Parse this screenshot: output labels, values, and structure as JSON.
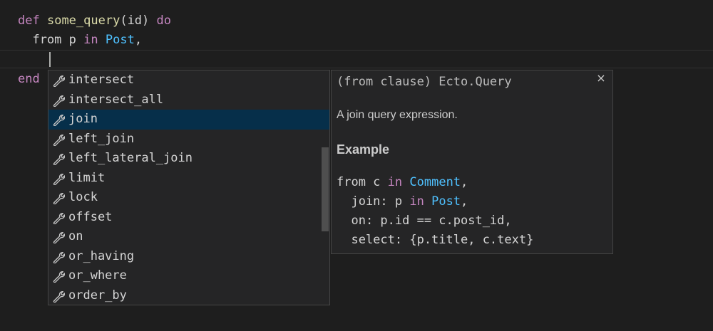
{
  "editor": {
    "lines": [
      {
        "tokens": [
          {
            "text": "def",
            "cls": "kw"
          },
          {
            "text": " ",
            "cls": "txt"
          },
          {
            "text": "some_query",
            "cls": "fn"
          },
          {
            "text": "(id) ",
            "cls": "txt"
          },
          {
            "text": "do",
            "cls": "kw"
          }
        ]
      },
      {
        "tokens": [
          {
            "text": "  from p ",
            "cls": "txt"
          },
          {
            "text": "in",
            "cls": "kw"
          },
          {
            "text": " ",
            "cls": "txt"
          },
          {
            "text": "Post",
            "cls": "mod"
          },
          {
            "text": ",",
            "cls": "txt"
          }
        ]
      },
      {
        "tokens": []
      },
      {
        "tokens": [
          {
            "text": "end",
            "cls": "kw"
          }
        ]
      }
    ]
  },
  "suggest": {
    "icon": "wrench-icon",
    "selected_index": 2,
    "items": [
      "intersect",
      "intersect_all",
      "join",
      "left_join",
      "left_lateral_join",
      "limit",
      "lock",
      "offset",
      "on",
      "or_having",
      "or_where",
      "order_by"
    ]
  },
  "docs": {
    "header": "(from clause) Ecto.Query",
    "close_label": "×",
    "description": "A join query expression.",
    "section_title": "Example",
    "code_lines": [
      [
        {
          "text": "from c ",
          "cls": "txt"
        },
        {
          "text": "in",
          "cls": "kw"
        },
        {
          "text": " ",
          "cls": "txt"
        },
        {
          "text": "Comment",
          "cls": "mod"
        },
        {
          "text": ",",
          "cls": "txt"
        }
      ],
      [
        {
          "text": "  join: p ",
          "cls": "txt"
        },
        {
          "text": "in",
          "cls": "kw"
        },
        {
          "text": " ",
          "cls": "txt"
        },
        {
          "text": "Post",
          "cls": "mod"
        },
        {
          "text": ",",
          "cls": "txt"
        }
      ],
      [
        {
          "text": "  on: p.id == c.post_id,",
          "cls": "txt"
        }
      ],
      [
        {
          "text": "  select: {p.title, c.text}",
          "cls": "txt"
        }
      ]
    ]
  },
  "colors": {
    "background": "#1e1e1e",
    "keyword": "#c586c0",
    "function": "#dcdcaa",
    "module": "#4fc1ff",
    "selection": "#062f4a"
  }
}
